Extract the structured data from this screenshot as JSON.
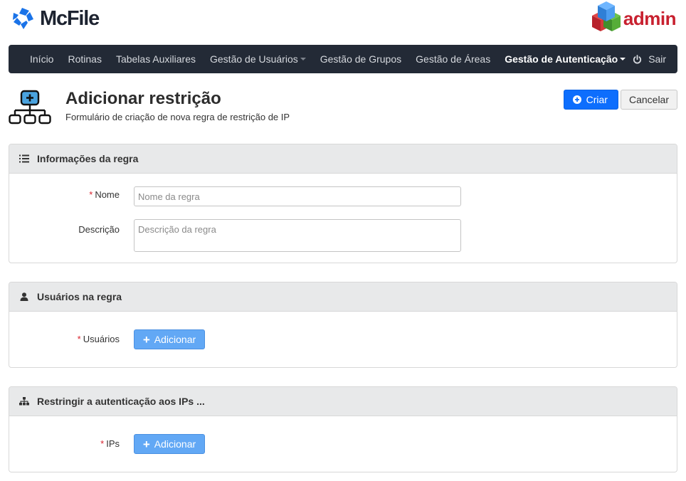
{
  "brand": {
    "name": "McFile",
    "admin_label": "admin"
  },
  "nav": {
    "items": [
      {
        "label": "Início",
        "dropdown": false,
        "active": false
      },
      {
        "label": "Rotinas",
        "dropdown": false,
        "active": false
      },
      {
        "label": "Tabelas Auxiliares",
        "dropdown": false,
        "active": false
      },
      {
        "label": "Gestão de Usuários",
        "dropdown": true,
        "active": false
      },
      {
        "label": "Gestão de Grupos",
        "dropdown": false,
        "active": false
      },
      {
        "label": "Gestão de Áreas",
        "dropdown": false,
        "active": false
      },
      {
        "label": "Gestão de Autenticação",
        "dropdown": true,
        "active": true
      }
    ],
    "logout_label": "Sair"
  },
  "page": {
    "title": "Adicionar restrição",
    "subtitle": "Formulário de criação de nova regra de restrição de IP",
    "create_label": "Criar",
    "cancel_label": "Cancelar"
  },
  "rule_info": {
    "title": "Informações da regra",
    "name_label": "Nome",
    "name_placeholder": "Nome da regra",
    "name_value": "",
    "description_label": "Descrição",
    "description_placeholder": "Descrição da regra",
    "description_value": ""
  },
  "users": {
    "title": "Usuários na regra",
    "field_label": "Usuários",
    "add_label": "Adicionar"
  },
  "ips": {
    "title": "Restringir a autenticação aos IPs ...",
    "field_label": "IPs",
    "add_label": "Adicionar"
  },
  "colors": {
    "navbar": "#232a36",
    "primary": "#0d6efd",
    "add_button": "#62a8f5",
    "required": "#d9232e",
    "brand_blue": "#1a73e8",
    "admin_red": "#c8202f"
  },
  "icons": {
    "brand": "mcfile-logo-icon",
    "admin": "cubes-icon",
    "logout": "power-icon",
    "page": "sitemap-add-icon",
    "create": "plus-circle-icon",
    "rule_info": "list-icon",
    "users": "user-icon",
    "ips": "sitemap-icon",
    "add": "plus-icon"
  }
}
